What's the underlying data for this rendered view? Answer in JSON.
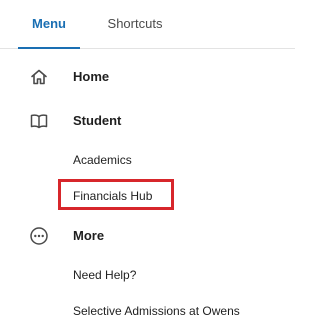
{
  "tabs": [
    {
      "label": "Menu",
      "active": true
    },
    {
      "label": "Shortcuts",
      "active": false
    }
  ],
  "nav": {
    "home": {
      "label": "Home",
      "icon": "home-icon"
    },
    "student": {
      "label": "Student",
      "icon": "book-icon",
      "items": [
        {
          "label": "Academics"
        },
        {
          "label": "Financials Hub",
          "highlighted": true
        }
      ]
    },
    "more": {
      "label": "More",
      "icon": "more-horizontal-icon",
      "items": [
        {
          "label": "Need Help?"
        },
        {
          "label": "Selective Admissions at Owens"
        }
      ]
    }
  },
  "colors": {
    "accent": "#1a6fb3",
    "highlight": "#d7262b"
  }
}
